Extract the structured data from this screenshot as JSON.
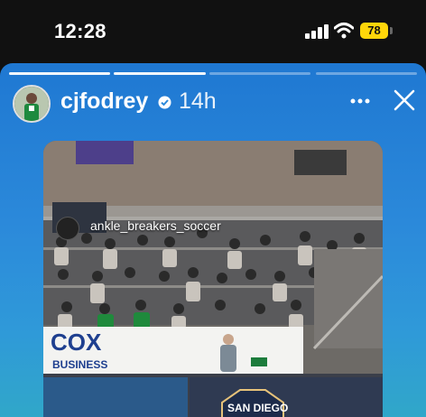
{
  "status_bar": {
    "time": "12:28",
    "battery": "78",
    "signal_icon": "cellular-signal-icon",
    "wifi_icon": "wifi-icon"
  },
  "story": {
    "username": "cjfodrey",
    "time_ago": "14h",
    "verified_icon": "verified-badge-icon",
    "more_icon": "more-options-icon",
    "close_icon": "close-icon",
    "segments": 4,
    "active_segment": 2,
    "background_colors": [
      "#1f78d2",
      "#30a7c9"
    ]
  },
  "shared_post": {
    "account_tag": "ankle_breakers_soccer",
    "banner_text": "COX",
    "banner_subtext": "BUSINESS",
    "badge_text": "SAN DIEGO"
  }
}
